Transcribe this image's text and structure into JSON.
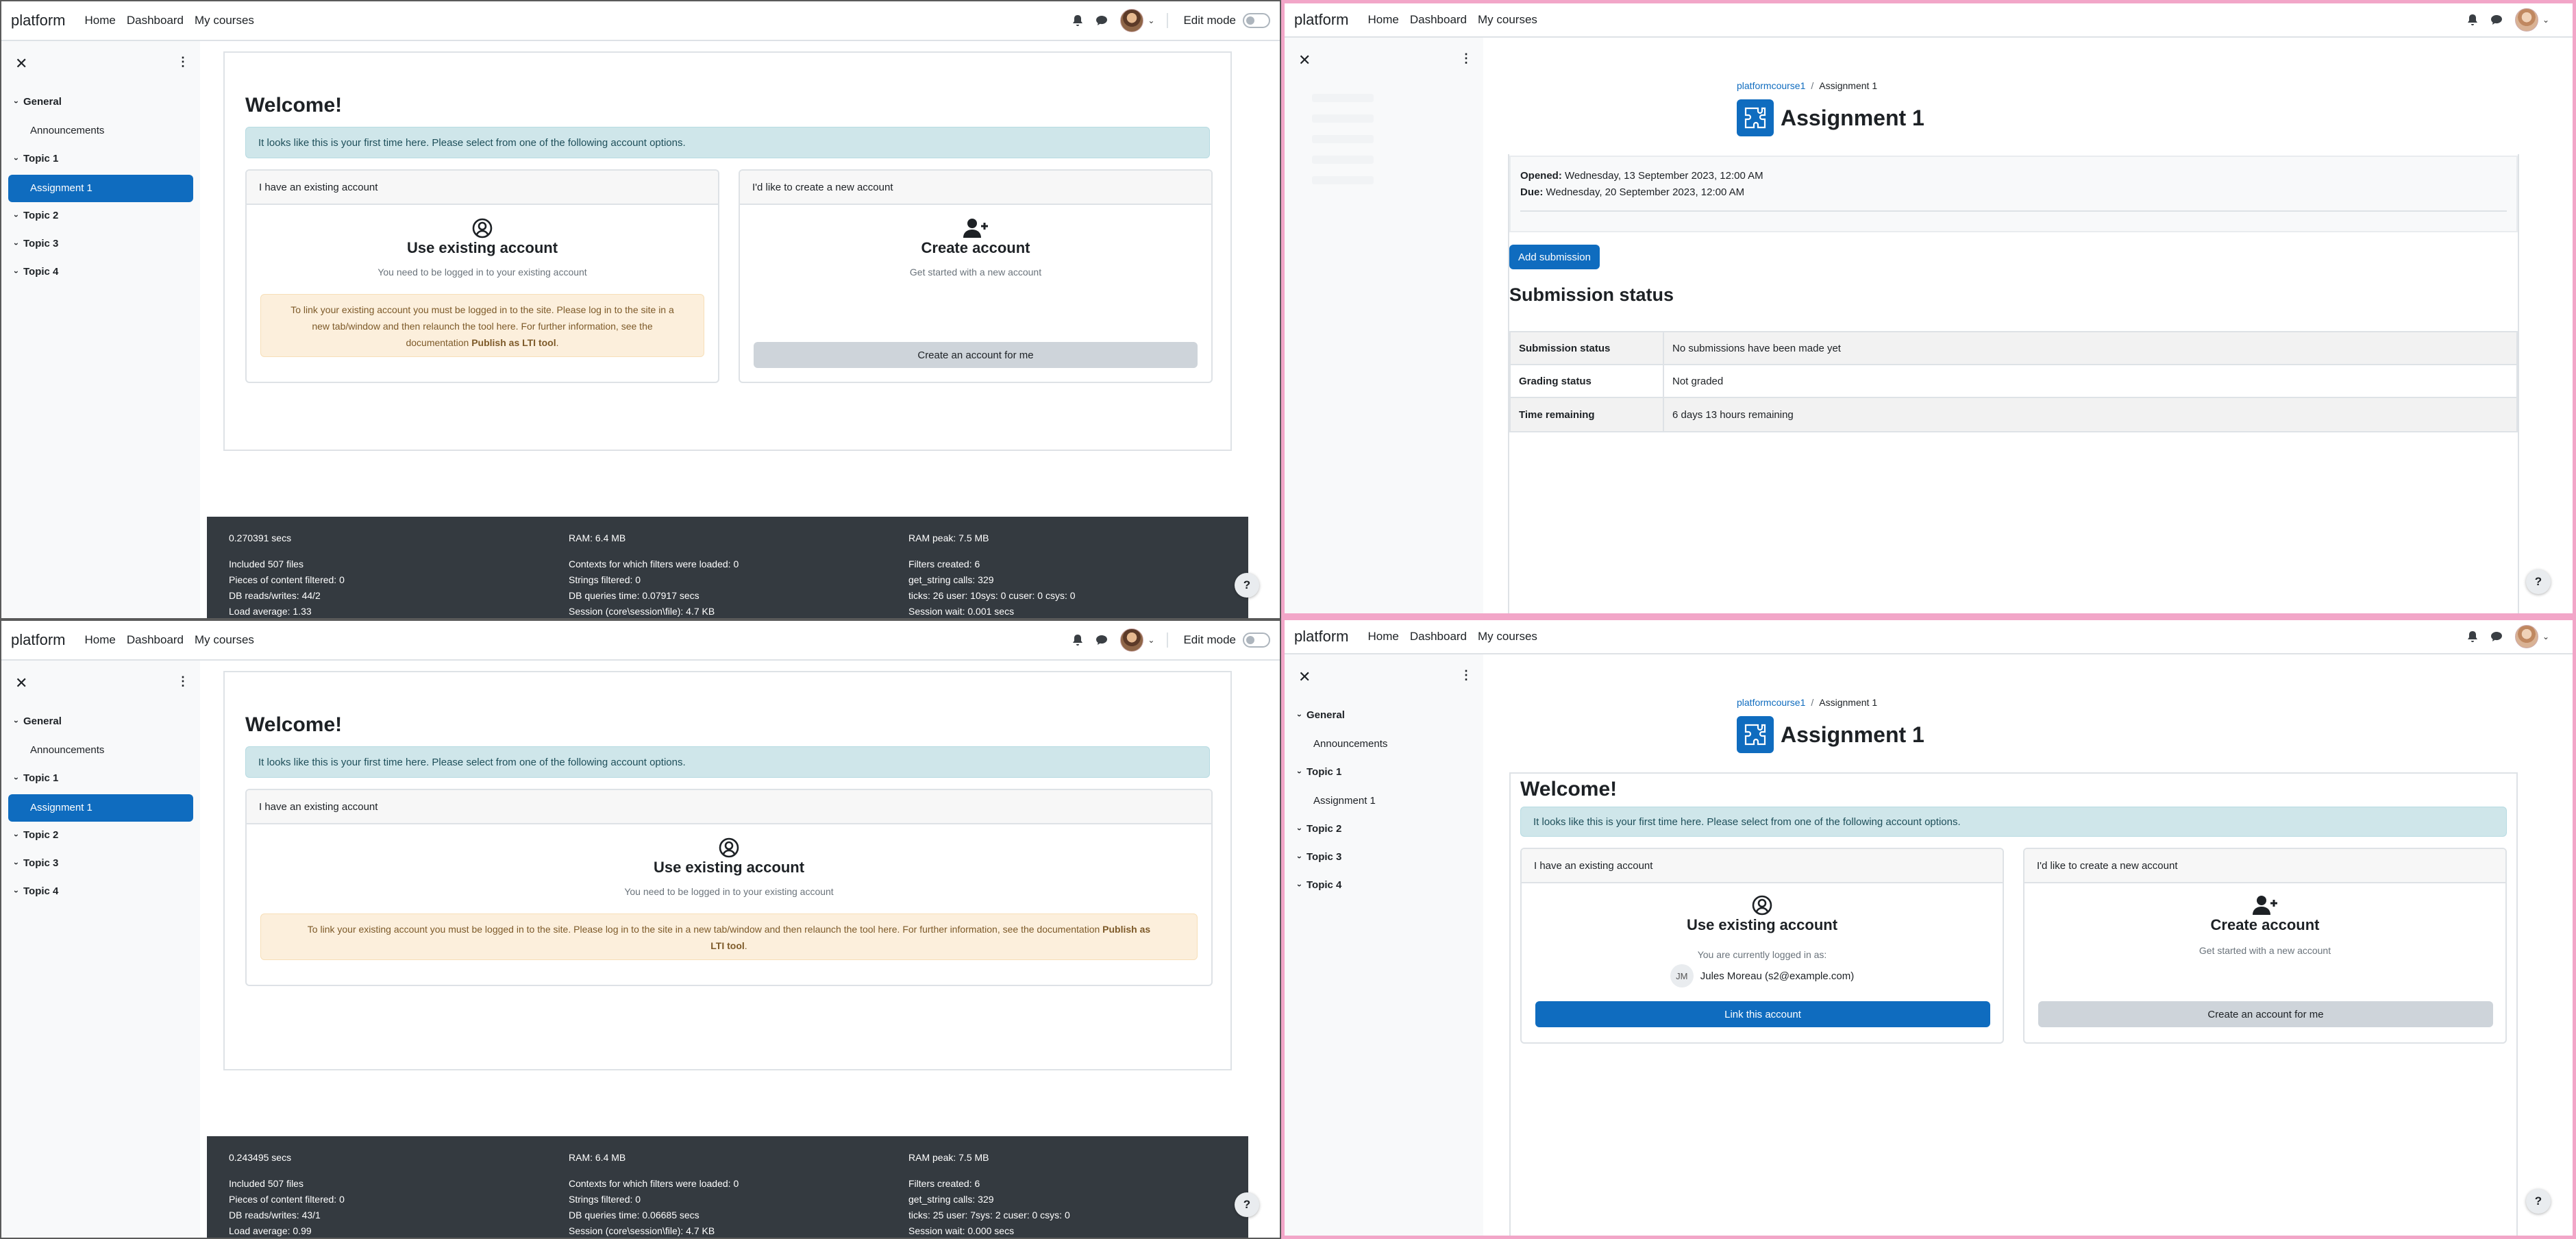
{
  "nav": {
    "brand": "platform",
    "links": [
      "Home",
      "Dashboard",
      "My courses"
    ],
    "edit_mode": "Edit mode"
  },
  "course_index": {
    "sections": [
      {
        "label": "General",
        "items": [
          "Announcements"
        ]
      },
      {
        "label": "Topic 1",
        "items": [
          "Assignment 1"
        ]
      },
      {
        "label": "Topic 2",
        "items": []
      },
      {
        "label": "Topic 3",
        "items": []
      },
      {
        "label": "Topic 4",
        "items": []
      }
    ]
  },
  "welcome": {
    "heading": "Welcome!",
    "info": "It looks like this is your first time here. Please select from one of the following account options.",
    "existing": {
      "header": "I have an existing account",
      "title": "Use existing account",
      "subtitle": "You need to be logged in to your existing account",
      "warning_lines": [
        "To link your existing account you must be logged in to the site. Please log in to the site in a",
        "new tab/window and then relaunch the tool here. For further information, see the",
        "documentation "
      ],
      "warning_wide_lines": [
        "To link your existing account you must be logged in to the site. Please log in to the site in a new tab/window and then relaunch the tool here. For further information, see the documentation ",
        "LTI tool"
      ],
      "warning_bold": "Publish as LTI tool",
      "warning_bold_wide": "Publish as",
      "logged_in_as": "You are currently logged in as:",
      "user_initials": "JM",
      "user_name": "Jules Moreau (s2@example.com)",
      "link_button": "Link this account"
    },
    "create": {
      "header": "I'd like to create a new account",
      "title": "Create account",
      "subtitle": "Get started with a new account",
      "button": "Create an account for me"
    }
  },
  "perf_top": {
    "col1": [
      "0.270391 secs",
      "Included 507 files",
      "Pieces of content filtered: 0",
      "DB reads/writes: 44/2",
      "Load average: 1.33"
    ],
    "col2": [
      "RAM: 6.4 MB",
      "Contexts for which filters were loaded: 0",
      "Strings filtered: 0",
      "DB queries time: 0.07917 secs",
      "Session (core\\session\\file): 4.7 KB"
    ],
    "col3": [
      "RAM peak: 7.5 MB",
      "Filters created: 6",
      "get_string calls: 329",
      "ticks: 26 user: 10sys: 0 cuser: 0 csys: 0",
      "Session wait: 0.001 secs"
    ]
  },
  "perf_bottom": {
    "col1": [
      "0.243495 secs",
      "Included 507 files",
      "Pieces of content filtered: 0",
      "DB reads/writes: 43/1",
      "Load average: 0.99"
    ],
    "col2": [
      "RAM: 6.4 MB",
      "Contexts for which filters were loaded: 0",
      "Strings filtered: 0",
      "DB queries time: 0.06685 secs",
      "Session (core\\session\\file): 4.7 KB"
    ],
    "col3": [
      "RAM peak: 7.5 MB",
      "Filters created: 6",
      "get_string calls: 329",
      "ticks: 25 user: 7sys: 2 cuser: 0 csys: 0",
      "Session wait: 0.000 secs"
    ]
  },
  "assignment": {
    "breadcrumb_course": "platformcourse1",
    "breadcrumb_sep": "/",
    "breadcrumb_current": "Assignment 1",
    "title": "Assignment 1",
    "opened_label": "Opened:",
    "opened_value": "Wednesday, 13 September 2023, 12:00 AM",
    "due_label": "Due:",
    "due_value": "Wednesday, 20 September 2023, 12:00 AM",
    "add_submission": "Add submission",
    "status_heading": "Submission status",
    "table": [
      {
        "k": "Submission status",
        "v": "No submissions have been made yet"
      },
      {
        "k": "Grading status",
        "v": "Not graded"
      },
      {
        "k": "Time remaining",
        "v": "6 days 13 hours remaining"
      }
    ]
  },
  "help": "?",
  "colors": {
    "primary": "#0f6cbf",
    "footer": "#343a40",
    "info": "#cfe6ea",
    "warning": "#fcefdc"
  }
}
